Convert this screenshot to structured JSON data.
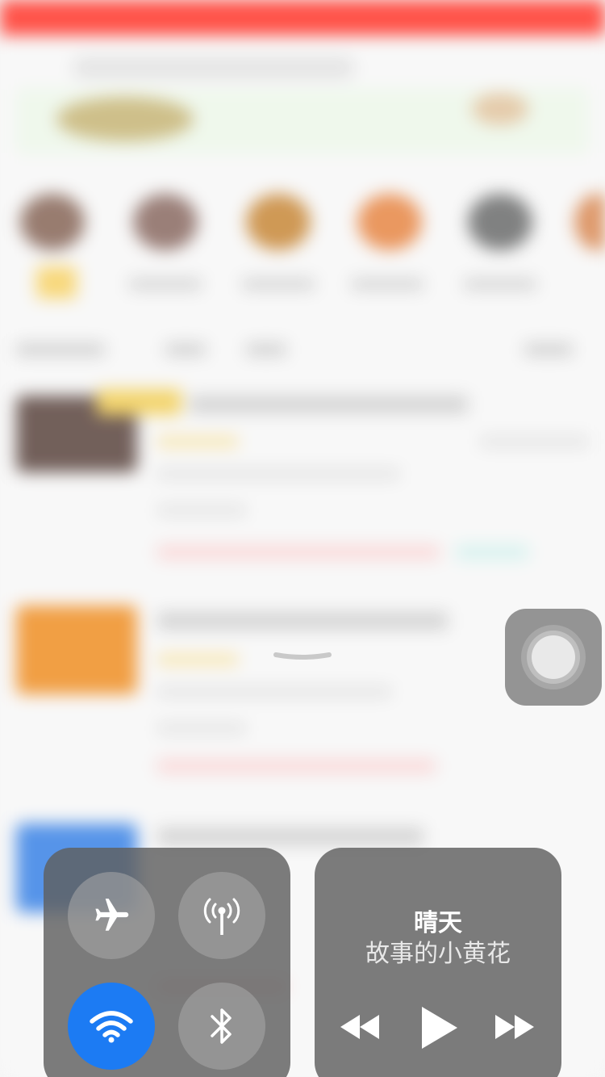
{
  "connectivity": {
    "airplane": {
      "icon": "airplane-icon",
      "state": "off"
    },
    "cellular": {
      "icon": "cellular-antenna-icon",
      "state": "off"
    },
    "wifi": {
      "icon": "wifi-icon",
      "state": "on"
    },
    "bluetooth": {
      "icon": "bluetooth-icon",
      "state": "off"
    }
  },
  "now_playing": {
    "title": "晴天",
    "artist": "故事的小黄花",
    "controls": {
      "rewind_icon": "rewind-icon",
      "play_icon": "play-icon",
      "forward_icon": "fast-forward-icon"
    }
  },
  "assistive_touch": {
    "icon": "assistive-touch-icon"
  },
  "colors": {
    "toggle_on": "#1c7bf3",
    "panel": "#5f5f5f",
    "app_topbar": "#ff3b30"
  }
}
